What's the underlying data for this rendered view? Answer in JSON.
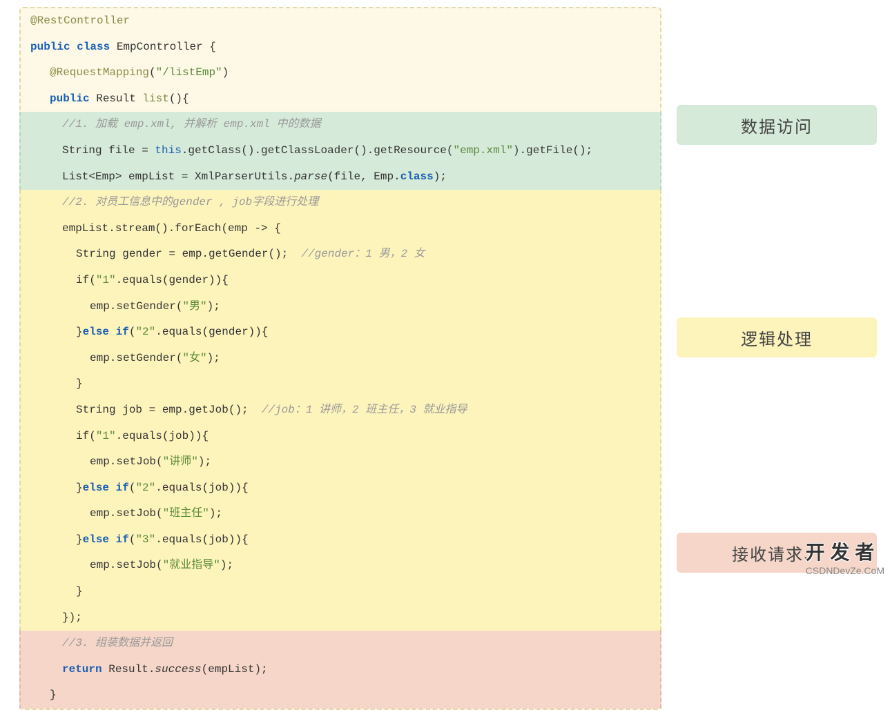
{
  "code": {
    "line1_anno": "@RestController",
    "line2_kw": "public class",
    "line2_rest": " EmpController {",
    "line3_anno": "@RequestMapping",
    "line3_paren_open": "(",
    "line3_str": "\"/listEmp\"",
    "line3_paren_close": ")",
    "line4_kw": "public",
    "line4_type": " Result ",
    "line4_method": "list",
    "line4_rest": "(){",
    "green_c1": "//1. 加载 emp.xml, 并解析 emp.xml 中的数据",
    "green_l1_a": "String file = ",
    "green_l1_this": "this",
    "green_l1_b": ".getClass().getClassLoader().getResource(",
    "green_l1_str": "\"emp.xml\"",
    "green_l1_c": ").getFile();",
    "green_l2_a": "List<Emp> empList = XmlParserUtils.",
    "green_l2_parse": "parse",
    "green_l2_b": "(file, Emp.",
    "green_l2_class": "class",
    "green_l2_c": ");",
    "yellow_c1": "//2. 对员工信息中的gender , job字段进行处理",
    "yellow_l1": "empList.stream().forEach(emp -> {",
    "yellow_l2_a": "String gender = emp.getGender();  ",
    "yellow_l2_c": "//gender：1 男，2 女",
    "yellow_l3_a": "if(",
    "yellow_l3_s": "\"1\"",
    "yellow_l3_b": ".equals(gender)){",
    "yellow_l4_a": "emp.setGender(",
    "yellow_l4_s": "\"男\"",
    "yellow_l4_b": ");",
    "yellow_l5_a": "}",
    "yellow_l5_kw": "else if",
    "yellow_l5_b": "(",
    "yellow_l5_s": "\"2\"",
    "yellow_l5_c": ".equals(gender)){",
    "yellow_l6_a": "emp.setGender(",
    "yellow_l6_s": "\"女\"",
    "yellow_l6_b": ");",
    "yellow_l7": "}",
    "yellow_l8_a": "String job = emp.getJob();  ",
    "yellow_l8_c": "//job：1 讲师，2 班主任，3 就业指导",
    "yellow_l9_a": "if(",
    "yellow_l9_s": "\"1\"",
    "yellow_l9_b": ".equals(job)){",
    "yellow_l10_a": "emp.setJob(",
    "yellow_l10_s": "\"讲师\"",
    "yellow_l10_b": ");",
    "yellow_l11_a": "}",
    "yellow_l11_kw": "else if",
    "yellow_l11_b": "(",
    "yellow_l11_s": "\"2\"",
    "yellow_l11_c": ".equals(job)){",
    "yellow_l12_a": "emp.setJob(",
    "yellow_l12_s": "\"班主任\"",
    "yellow_l12_b": ");",
    "yellow_l13_a": "}",
    "yellow_l13_kw": "else if",
    "yellow_l13_b": "(",
    "yellow_l13_s": "\"3\"",
    "yellow_l13_c": ".equals(job)){",
    "yellow_l14_a": "emp.setJob(",
    "yellow_l14_s": "\"就业指导\"",
    "yellow_l14_b": ");",
    "yellow_l15": "}",
    "yellow_l16": "});",
    "red_c1": "//3. 组装数据并返回",
    "red_l1_kw": "return",
    "red_l1_a": " Result.",
    "red_l1_m": "success",
    "red_l1_b": "(empList);",
    "red_l2": "}"
  },
  "labels": {
    "green": "数据访问",
    "yellow": "逻辑处理",
    "red": "接收请求、"
  },
  "watermark": {
    "main": "开 发 者",
    "sub": "CSDNDevZe.CoM"
  }
}
